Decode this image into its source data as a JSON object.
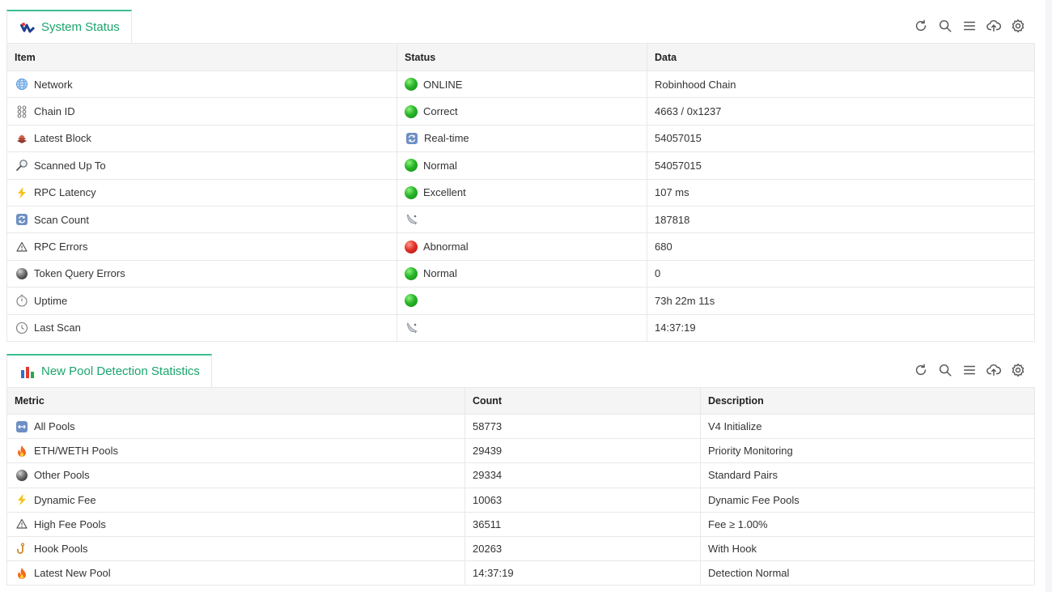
{
  "colors": {
    "accent": "#1aa56e",
    "online": "#29b52a",
    "error": "#e2322a",
    "header_bg": "#f5f5f5"
  },
  "system_status": {
    "title": "System Status",
    "tab_icon": "wave-logo-icon",
    "toolbar": [
      "refresh-icon",
      "search-icon",
      "columns-icon",
      "export-icon",
      "settings-icon"
    ],
    "columns": [
      "Item",
      "Status",
      "Data"
    ],
    "rows": [
      {
        "icon": "globe-icon",
        "item": "Network",
        "status_icon": "green-dot",
        "status": "ONLINE",
        "data": "Robinhood Chain"
      },
      {
        "icon": "link-chain-icon",
        "item": "Chain ID",
        "status_icon": "green-dot",
        "status": "Correct",
        "data": "4663 / 0x1237"
      },
      {
        "icon": "bricks-icon",
        "item": "Latest Block",
        "status_icon": "sync-icon",
        "status": "Real-time",
        "data": "54057015"
      },
      {
        "icon": "magnifier-icon",
        "item": "Scanned Up To",
        "status_icon": "green-dot",
        "status": "Normal",
        "data": "54057015"
      },
      {
        "icon": "lightning-icon",
        "item": "RPC Latency",
        "status_icon": "green-dot",
        "status": "Excellent",
        "data": "107 ms"
      },
      {
        "icon": "sync-icon",
        "item": "Scan Count",
        "status_icon": "satellite-icon",
        "status": "",
        "data": "187818"
      },
      {
        "icon": "warning-icon",
        "item": "RPC Errors",
        "status_icon": "red-dot",
        "status": "Abnormal",
        "data": "680"
      },
      {
        "icon": "gray-ball-icon",
        "item": "Token Query Errors",
        "status_icon": "green-dot",
        "status": "Normal",
        "data": "0"
      },
      {
        "icon": "stopwatch-icon",
        "item": "Uptime",
        "status_icon": "green-dot",
        "status": "",
        "data": "73h 22m 11s"
      },
      {
        "icon": "clock-icon",
        "item": "Last Scan",
        "status_icon": "satellite-icon",
        "status": "",
        "data": "14:37:19"
      }
    ]
  },
  "pool_stats": {
    "title": "New Pool Detection Statistics",
    "tab_icon": "bar-chart-icon",
    "toolbar": [
      "refresh-icon",
      "search-icon",
      "columns-icon",
      "export-icon",
      "settings-icon"
    ],
    "columns": [
      "Metric",
      "Count",
      "Description"
    ],
    "rows": [
      {
        "icon": "left-right-arrow-icon",
        "metric": "All Pools",
        "count": "58773",
        "description": "V4 Initialize"
      },
      {
        "icon": "fire-icon",
        "metric": "ETH/WETH Pools",
        "count": "29439",
        "description": "Priority Monitoring"
      },
      {
        "icon": "gray-ball-icon",
        "metric": "Other Pools",
        "count": "29334",
        "description": "Standard Pairs"
      },
      {
        "icon": "lightning-icon",
        "metric": "Dynamic Fee",
        "count": "10063",
        "description": "Dynamic Fee Pools"
      },
      {
        "icon": "warning-icon",
        "metric": "High Fee Pools",
        "count": "36511",
        "description": "Fee ≥ 1.00%"
      },
      {
        "icon": "hook-icon",
        "metric": "Hook Pools",
        "count": "20263",
        "description": "With Hook"
      },
      {
        "icon": "fire-icon",
        "metric": "Latest New Pool",
        "count": "14:37:19",
        "description": "Detection Normal"
      }
    ]
  }
}
